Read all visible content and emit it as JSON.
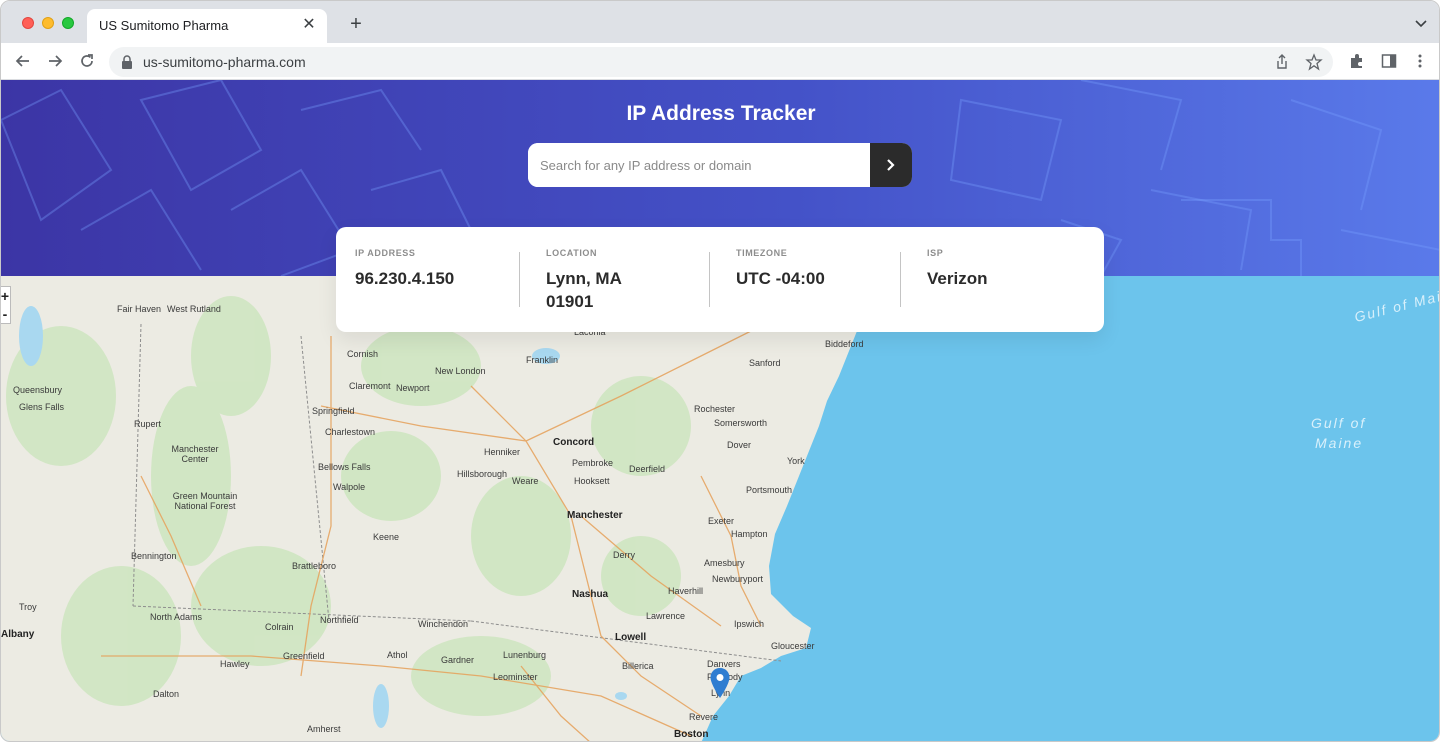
{
  "browser": {
    "tab_title": "US Sumitomo Pharma",
    "url": "us-sumitomo-pharma.com"
  },
  "hero": {
    "title": "IP Address Tracker",
    "search_placeholder": "Search for any IP address or domain"
  },
  "info": [
    {
      "label": "IP ADDRESS",
      "value": "96.230.4.150"
    },
    {
      "label": "LOCATION",
      "value": "Lynn, MA 01901"
    },
    {
      "label": "TIMEZONE",
      "value": "UTC -04:00"
    },
    {
      "label": "ISP",
      "value": "Verizon"
    }
  ],
  "map": {
    "zoom_in": "+",
    "zoom_out": "-",
    "sea_labels": [
      "Gulf of Maine",
      "Gulf of",
      "Maine"
    ],
    "places": [
      "Fair Haven",
      "West Rutland",
      "Cornish",
      "Claremont",
      "Newport",
      "New London",
      "Franklin",
      "Laconia",
      "Sanford",
      "Biddeford",
      "Queensbury",
      "Glens Falls",
      "Rupert",
      "Springfield",
      "Charlestown",
      "Rochester",
      "Somersworth",
      "Concord",
      "Henniker",
      "Dover",
      "Manchester Center",
      "Pembroke",
      "Deerfield",
      "York",
      "Bellows Falls",
      "Hillsborough",
      "Weare",
      "Hooksett",
      "Portsmouth",
      "Green Mountain National Forest",
      "Walpole",
      "Manchester",
      "Exeter",
      "Keene",
      "Hampton",
      "Bennington",
      "Derry",
      "Brattleboro",
      "Amesbury",
      "Newburyport",
      "Nashua",
      "Haverhill",
      "North Adams",
      "Northfield",
      "Lawrence",
      "Colrain",
      "Winchendon",
      "Ipswich",
      "Troy",
      "Lowell",
      "Gloucester",
      "Albany",
      "Greenfield",
      "Athol",
      "Gardner",
      "Lunenburg",
      "Billerica",
      "Hawley",
      "Leominster",
      "Danvers",
      "Peabody",
      "Lynn",
      "Dalton",
      "Revere",
      "Amherst",
      "Boston"
    ]
  },
  "colors": {
    "hero_start": "#3c35a5",
    "hero_end": "#5a7aea",
    "sea": "#6cc4ec",
    "land": "#ecebe3",
    "button": "#2b2b2b",
    "pin": "#2f7dd1"
  }
}
